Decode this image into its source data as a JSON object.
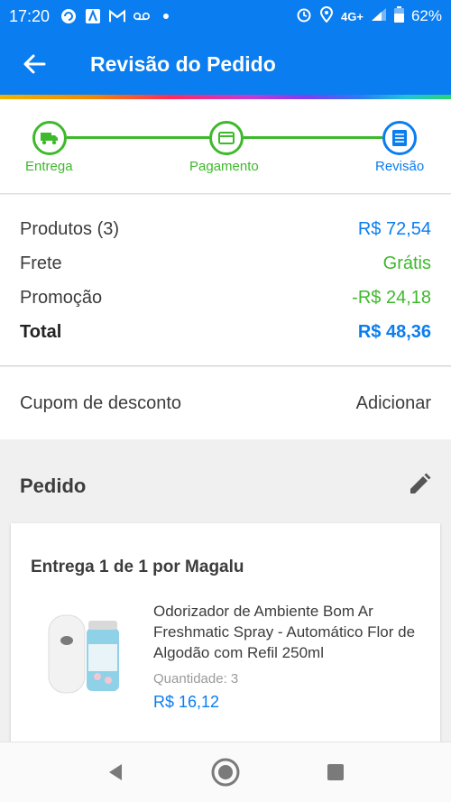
{
  "status_bar": {
    "time": "17:20",
    "network": "4G+",
    "battery": "62%"
  },
  "header": {
    "title": "Revisão do Pedido"
  },
  "stepper": {
    "steps": [
      {
        "label": "Entrega",
        "icon": "truck-icon",
        "state": "done"
      },
      {
        "label": "Pagamento",
        "icon": "card-icon",
        "state": "done"
      },
      {
        "label": "Revisão",
        "icon": "list-icon",
        "state": "active"
      }
    ]
  },
  "summary": {
    "products_label": "Produtos (3)",
    "products_value": "R$ 72,54",
    "shipping_label": "Frete",
    "shipping_value": "Grátis",
    "promo_label": "Promoção",
    "promo_value": "-R$ 24,18",
    "total_label": "Total",
    "total_value": "R$ 48,36"
  },
  "coupon": {
    "label": "Cupom de desconto",
    "action": "Adicionar"
  },
  "order": {
    "title": "Pedido",
    "shipment": "Entrega 1 de 1 por Magalu",
    "item": {
      "name": "Odorizador de Ambiente Bom Ar Freshmatic Spray - Automático Flor de Algodão com Refil 250ml",
      "quantity_label": "Quantidade:",
      "quantity": "3",
      "price": "R$ 16,12"
    }
  },
  "colors": {
    "primary": "#0a7df0",
    "success": "#3db92b",
    "text": "#3c3c3c"
  }
}
